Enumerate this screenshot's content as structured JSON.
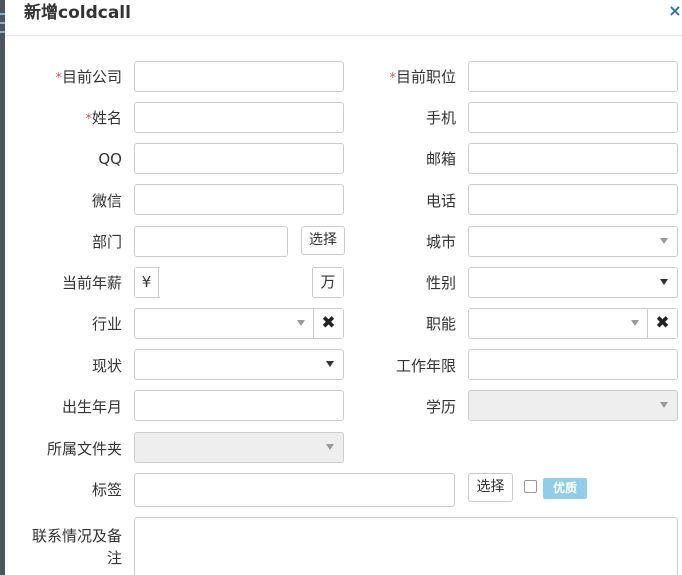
{
  "modal": {
    "title": "新增coldcall",
    "close": "×"
  },
  "fields": {
    "company": {
      "label": "目前公司",
      "value": ""
    },
    "position": {
      "label": "目前职位",
      "value": ""
    },
    "name": {
      "label": "姓名",
      "value": ""
    },
    "mobile": {
      "label": "手机",
      "value": ""
    },
    "qq": {
      "label": "QQ",
      "value": ""
    },
    "email": {
      "label": "邮箱",
      "value": ""
    },
    "wechat": {
      "label": "微信",
      "value": ""
    },
    "phone": {
      "label": "电话",
      "value": ""
    },
    "department": {
      "label": "部门",
      "value": "",
      "button": "选择"
    },
    "city": {
      "label": "城市",
      "value": ""
    },
    "salary": {
      "label": "当前年薪",
      "prefix": "¥",
      "suffix": "万",
      "value": ""
    },
    "gender": {
      "label": "性别",
      "value": ""
    },
    "industry": {
      "label": "行业",
      "value": "",
      "clear": "✖"
    },
    "function": {
      "label": "职能",
      "value": "",
      "clear": "✖"
    },
    "status": {
      "label": "现状",
      "value": ""
    },
    "work_years": {
      "label": "工作年限",
      "value": ""
    },
    "birth": {
      "label": "出生年月",
      "value": ""
    },
    "education": {
      "label": "学历",
      "value": ""
    },
    "folder": {
      "label": "所属文件夹",
      "value": ""
    },
    "tags": {
      "label": "标签",
      "value": "",
      "button": "选择",
      "badge": "优质"
    },
    "notes": {
      "label_line1": "联系情况及备",
      "label_line2": "注",
      "value": ""
    }
  },
  "required_mark": "*"
}
